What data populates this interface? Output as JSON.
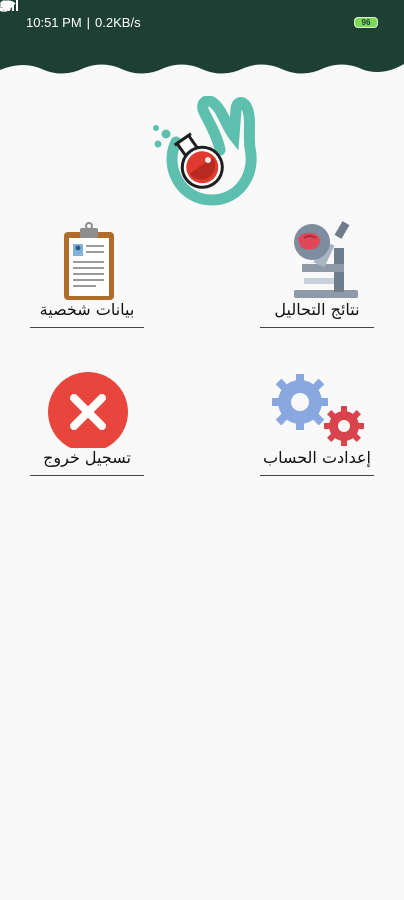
{
  "status_bar": {
    "time": "10:51 PM",
    "speed": "0.2KB/s",
    "battery": "96"
  },
  "menu": {
    "personal_data": "بيانات شخصية",
    "test_results": "نتائج التحاليل",
    "logout": "تسجيل خروج",
    "account_settings": "إعدادت الحساب"
  },
  "colors": {
    "header": "#1e4034",
    "logo_teal": "#5dbfae",
    "logout_red": "#e8453c",
    "gear_blue": "#8aa8e0",
    "gear_red": "#d9434c"
  },
  "icons": {
    "logo": "lab-flask-hand-logo",
    "personal_data": "clipboard-icon",
    "test_results": "microscope-icon",
    "logout": "close-icon",
    "account_settings": "gears-icon"
  }
}
